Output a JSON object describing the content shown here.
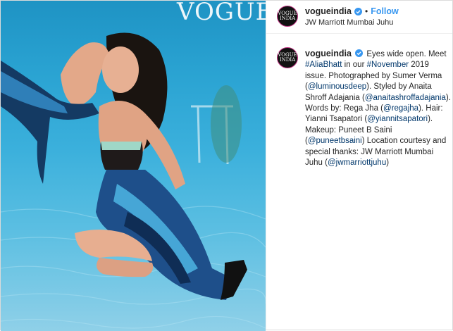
{
  "image": {
    "magazine_title": "VOGUE"
  },
  "header": {
    "avatar_text": "VOGUE INDIA",
    "username": "vogueindia",
    "separator": "•",
    "follow_label": "Follow",
    "location": "JW Marriott Mumbai Juhu"
  },
  "caption": {
    "username": "vogueindia",
    "segments": [
      {
        "text": "Eyes wide open. Meet ",
        "style": "plain"
      },
      {
        "text": "#AliaBhatt",
        "style": "link"
      },
      {
        "text": " in our ",
        "style": "plain"
      },
      {
        "text": "#November",
        "style": "link"
      },
      {
        "text": " 2019 issue. Photographed by Sumer Verma (",
        "style": "plain"
      },
      {
        "text": "@luminousdeep",
        "style": "link"
      },
      {
        "text": "). Styled by Anaita Shroff Adajania (",
        "style": "plain"
      },
      {
        "text": "@anaitashroffadajania",
        "style": "link"
      },
      {
        "text": "). Words by: Rega Jha (",
        "style": "plain"
      },
      {
        "text": "@regajha",
        "style": "link"
      },
      {
        "text": "). Hair: Yianni Tsapatori (",
        "style": "plain"
      },
      {
        "text": "@yiannitsapatori",
        "style": "link"
      },
      {
        "text": "). Makeup: Puneet B Saini (",
        "style": "plain"
      },
      {
        "text": "@puneetbsaini",
        "style": "link"
      },
      {
        "text": ") Location courtesy and special thanks: JW Marriott Mumbai Juhu (",
        "style": "plain"
      },
      {
        "text": "@jwmarriottjuhu",
        "style": "link"
      },
      {
        "text": ")",
        "style": "plain"
      }
    ]
  },
  "colors": {
    "link": "#00376b",
    "follow": "#3897f0",
    "verified": "#3897f0",
    "text": "#262626"
  }
}
